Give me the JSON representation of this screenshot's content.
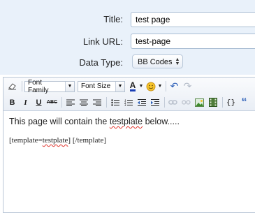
{
  "form": {
    "title_label": "Title:",
    "title_value": "test page",
    "link_label": "Link URL:",
    "link_value": "test-page",
    "datatype_label": "Data Type:",
    "datatype_value": "BB Codes"
  },
  "toolbar": {
    "font_family": "Font Family",
    "font_size": "Font Size",
    "bold": "B",
    "italic": "I",
    "underline": "U",
    "strike": "ABC",
    "text_color": "A",
    "undo": "↶",
    "redo": "↷",
    "code": "{}",
    "quote": "“"
  },
  "content": {
    "line1_pre": "This page will contain the ",
    "line1_misspelled": "testplate",
    "line1_post": " below.....",
    "line2_pre": "[template=",
    "line2_misspelled": "testplate",
    "line2_post": "] [/template]"
  },
  "colors": {
    "panel_bg": "#e9f1fa",
    "accent_border": "#a9bdd3",
    "spellcheck": "#e0342c"
  }
}
